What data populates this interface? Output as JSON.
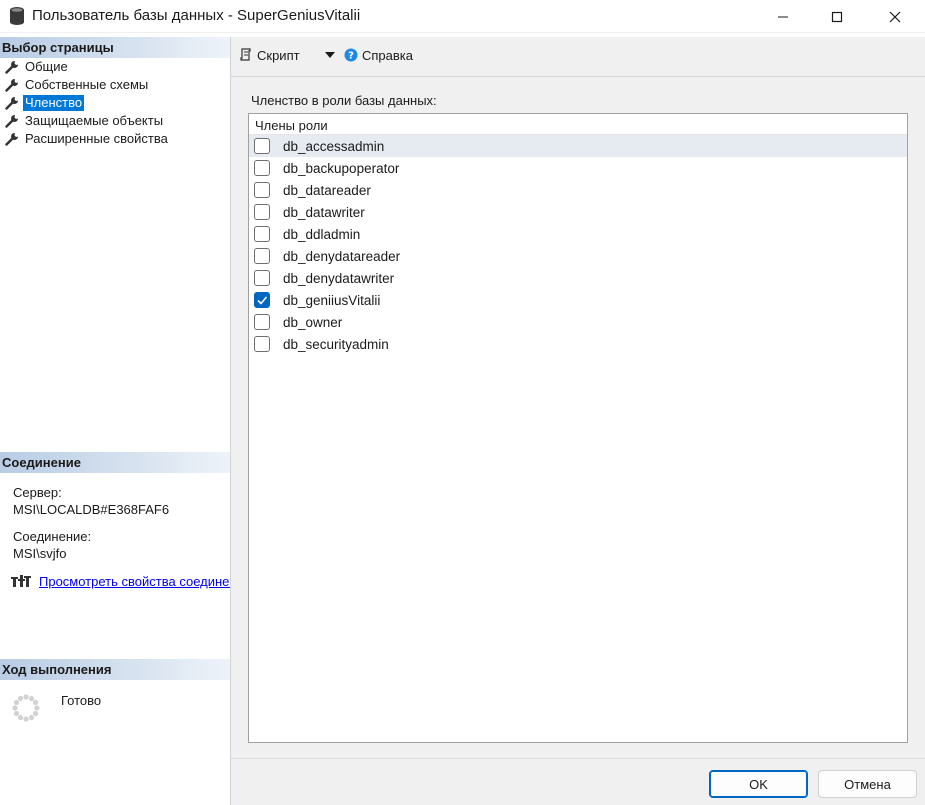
{
  "window": {
    "title": "Пользователь базы данных - SuperGeniusVitalii"
  },
  "left_panel": {
    "page_select_header": "Выбор страницы",
    "pages": [
      {
        "label": "Общие",
        "icon": "wrench-icon",
        "selected": false
      },
      {
        "label": "Собственные схемы",
        "icon": "wrench-icon",
        "selected": false
      },
      {
        "label": "Членство",
        "icon": "wrench-icon",
        "selected": true
      },
      {
        "label": "Защищаемые объекты",
        "icon": "wrench-icon",
        "selected": false
      },
      {
        "label": "Расширенные свойства",
        "icon": "wrench-icon",
        "selected": false
      }
    ],
    "connection_header": "Соединение",
    "server_label": "Сервер:",
    "server_value": "MSI\\LOCALDB#E368FAF6",
    "connection_label": "Соединение:",
    "connection_value": "MSI\\svjfo",
    "view_connection_link": "Просмотреть свойства соединения",
    "progress_header": "Ход выполнения",
    "progress_status": "Готово"
  },
  "toolbar": {
    "script_label": "Скрипт",
    "help_label": "Справка"
  },
  "membership": {
    "section_label": "Членство в роли базы данных:",
    "column_header": "Члены роли",
    "roles": [
      {
        "name": "db_accessadmin",
        "checked": false
      },
      {
        "name": "db_backupoperator",
        "checked": false
      },
      {
        "name": "db_datareader",
        "checked": false
      },
      {
        "name": "db_datawriter",
        "checked": false
      },
      {
        "name": "db_ddladmin",
        "checked": false
      },
      {
        "name": "db_denydatareader",
        "checked": false
      },
      {
        "name": "db_denydatawriter",
        "checked": false
      },
      {
        "name": "db_geniiusVitalii",
        "checked": true
      },
      {
        "name": "db_owner",
        "checked": false
      },
      {
        "name": "db_securityadmin",
        "checked": false
      }
    ]
  },
  "footer": {
    "ok_label": "OK",
    "cancel_label": "Отмена"
  },
  "colors": {
    "accent": "#0078d7",
    "checkbox_checked": "#0067c0",
    "section_header": "#b8cce4"
  }
}
